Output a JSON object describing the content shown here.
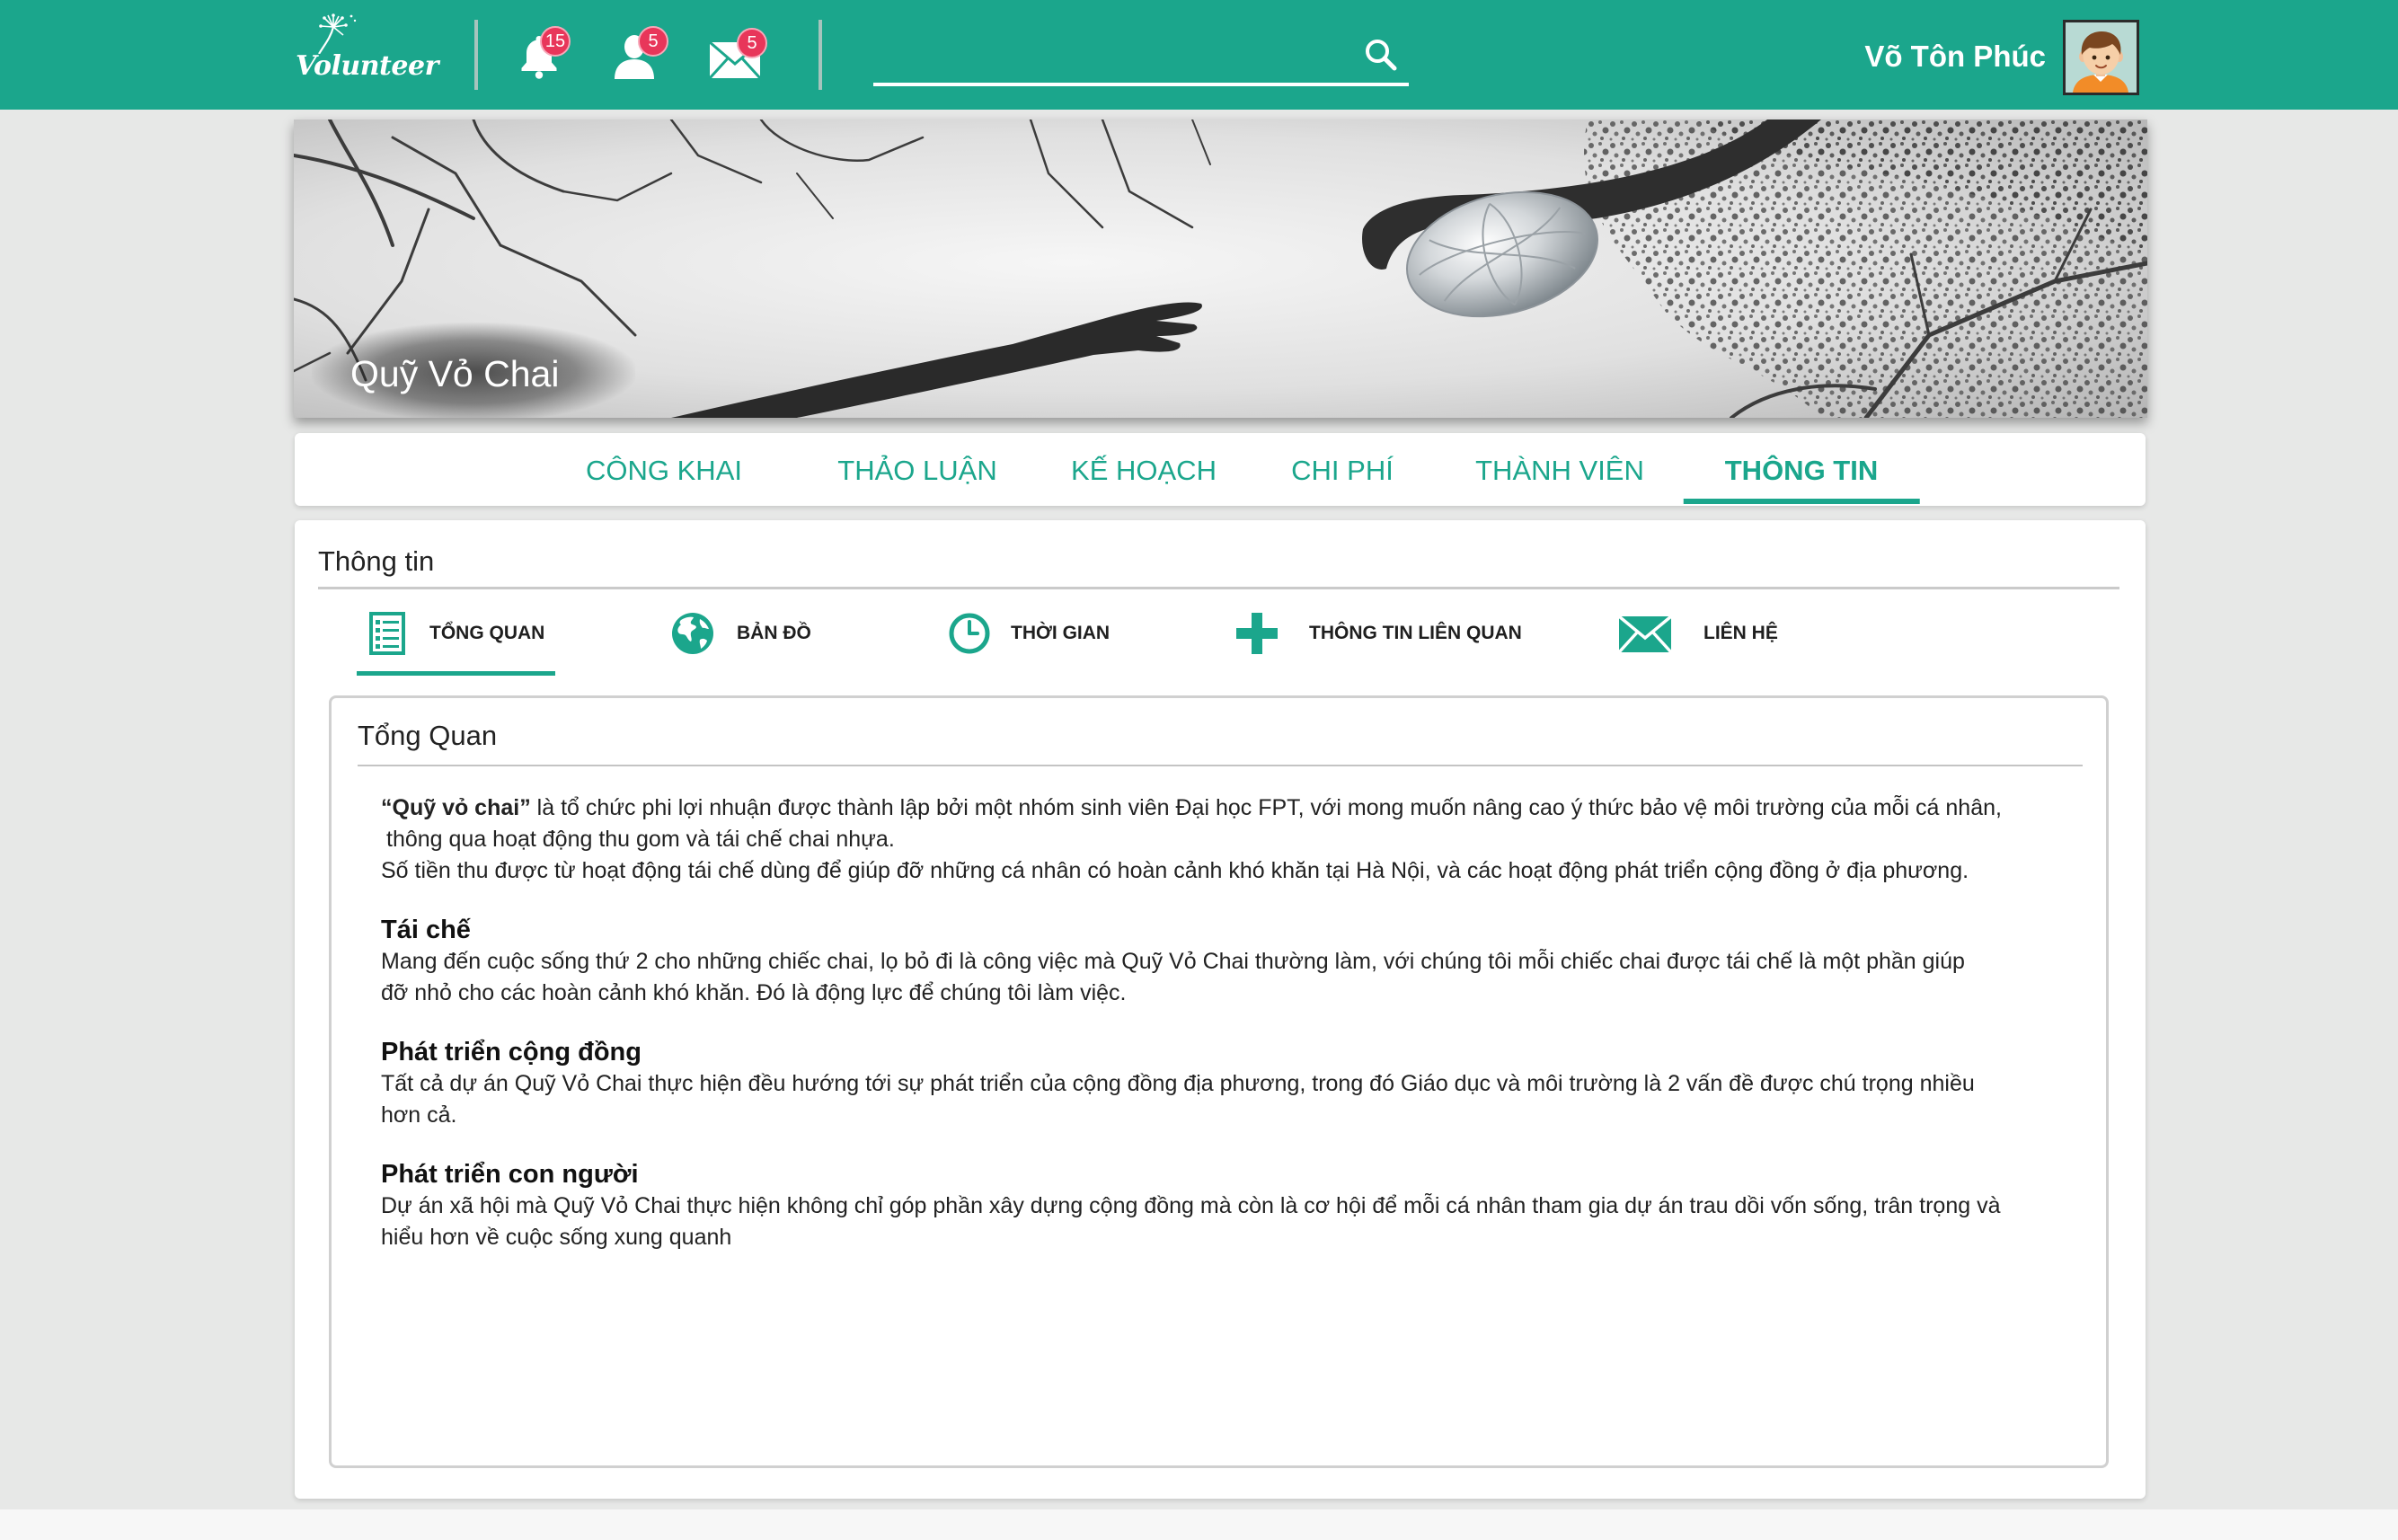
{
  "app": {
    "logo_text": "Volunteer"
  },
  "header": {
    "notifications_icon": "bell-icon",
    "notifications_count": "15",
    "friend_requests_icon": "user-icon",
    "friend_requests_count": "5",
    "messages_icon": "mail-icon",
    "messages_count": "5",
    "search_value": "",
    "search_icon": "search-icon",
    "user_name": "Võ Tôn Phúc"
  },
  "banner": {
    "title": "Quỹ Vỏ Chai"
  },
  "tabs": {
    "items": [
      "CÔNG KHAI",
      "THẢO LUẬN",
      "KẾ HOẠCH",
      "CHI PHÍ",
      "THÀNH VIÊN",
      "THÔNG TIN"
    ],
    "active_index": 5
  },
  "info": {
    "title": "Thông tin",
    "subtabs": [
      {
        "label": "TỔNG QUAN",
        "icon": "list-icon"
      },
      {
        "label": "BẢN ĐỒ",
        "icon": "globe-icon"
      },
      {
        "label": "THỜI GIAN",
        "icon": "clock-icon"
      },
      {
        "label": "THÔNG TIN LIÊN QUAN",
        "icon": "plus-icon"
      },
      {
        "label": "LIÊN HỆ",
        "icon": "mail-icon"
      }
    ],
    "active_subtab": 0,
    "panel": {
      "title": "Tổng Quan",
      "intro": {
        "org_name": "“Quỹ vỏ chai”",
        "line1_rest": " là tổ chức phi lợi nhuận được thành lập bởi một nhóm sinh viên Đại học FPT, với mong muốn nâng cao ý thức bảo vệ môi trường của mỗi cá nhân,",
        "line2": "thông qua hoạt động thu gom và tái chế chai nhựa.",
        "line3": "Số tiền thu được từ hoạt động tái chế dùng để giúp đỡ những cá nhân có hoàn cảnh khó khăn tại Hà Nội, và các hoạt động phát triển cộng đồng ở địa phương."
      },
      "sections": [
        {
          "title": "Tái chế",
          "lines": [
            "Mang đến cuộc sống thứ 2 cho những chiếc chai, lọ bỏ đi là công việc mà Quỹ Vỏ Chai thường làm, với chúng tôi mỗi chiếc chai được tái chế là một phần giúp",
            "đỡ nhỏ cho các hoàn cảnh khó khăn. Đó là động lực để chúng tôi làm việc."
          ]
        },
        {
          "title": "Phát triển cộng đồng",
          "lines": [
            "Tất cả dự án Quỹ Vỏ Chai thực hiện đều hướng tới sự phát triển của cộng đồng địa phương, trong đó Giáo dục và môi trường là 2 vấn đề được chú trọng nhiều",
            "hơn cả."
          ]
        },
        {
          "title": "Phát triển con người",
          "lines": [
            "Dự án xã hội mà Quỹ Vỏ Chai thực hiện không chỉ góp phần xây dựng cộng đồng mà còn là cơ hội để mỗi cá nhân tham gia dự án trau dồi vốn sống, trân trọng và",
            "hiểu hơn về cuộc sống xung quanh"
          ]
        }
      ]
    }
  },
  "colors": {
    "accent": "#1ba68c",
    "badge": "#e8365a",
    "page_background": "#e7e8e7",
    "card_background": "#ffffff"
  }
}
